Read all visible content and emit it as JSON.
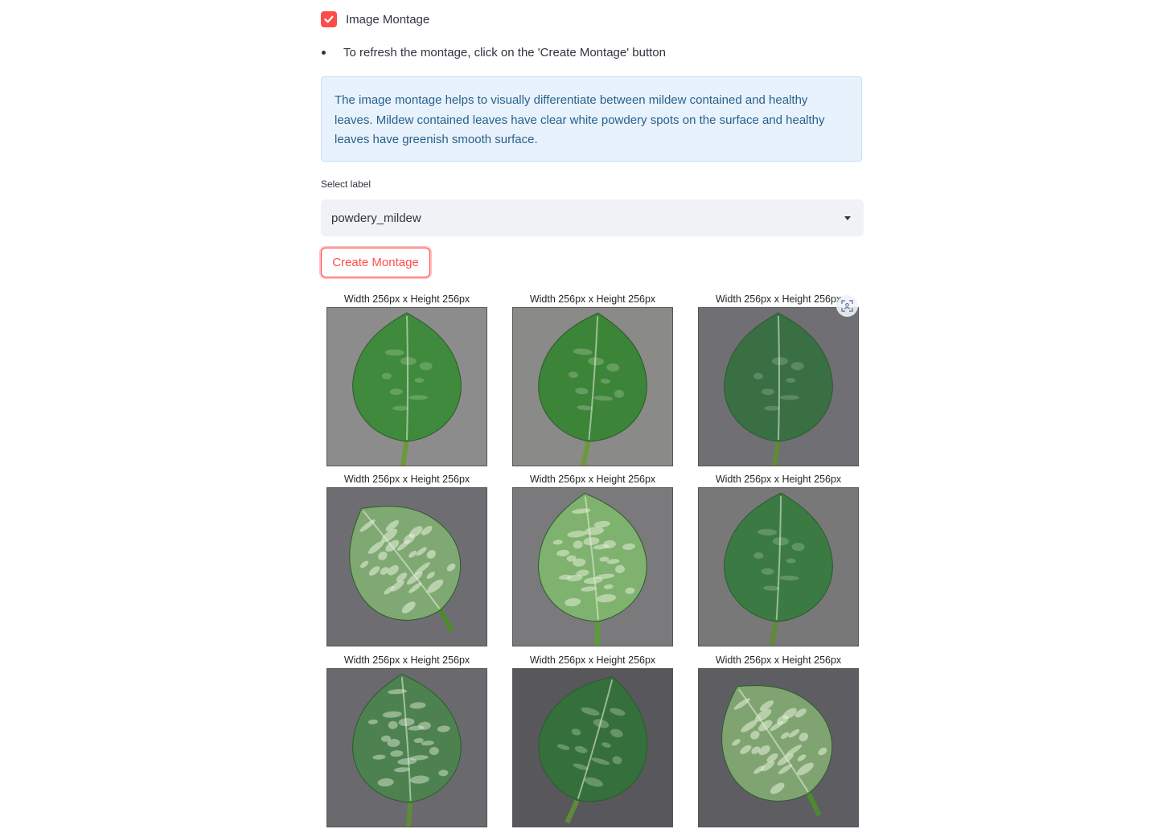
{
  "checkbox": {
    "label": "Image Montage",
    "checked": true,
    "accent": "#ff4b4b"
  },
  "bullet": {
    "text": "To refresh the montage, click on the 'Create Montage' button"
  },
  "info": {
    "text": "The image montage helps to visually differentiate between mildew contained and healthy leaves. Mildew contained leaves have clear white powdery spots on the surface and healthy leaves have greenish smooth surface."
  },
  "select": {
    "label": "Select label",
    "value": "powdery_mildew"
  },
  "button": {
    "label": "Create Montage"
  },
  "montage": {
    "captions": [
      "Width 256px x Height 256px",
      "Width 256px x Height 256px",
      "Width 256px x Height 256px",
      "Width 256px x Height 256px",
      "Width 256px x Height 256px",
      "Width 256px x Height 256px",
      "Width 256px x Height 256px",
      "Width 256px x Height 256px",
      "Width 256px x Height 256px"
    ],
    "fullscreen_icon": "fullscreen-icon"
  }
}
